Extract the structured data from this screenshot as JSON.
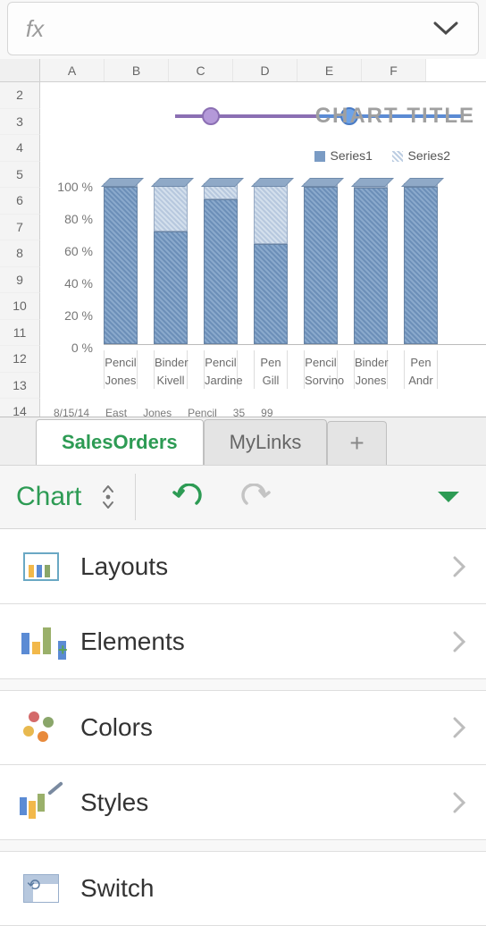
{
  "formula_bar": {
    "fx": "fx",
    "value": ""
  },
  "columns": [
    "A",
    "B",
    "C",
    "D",
    "E",
    "F"
  ],
  "rows": [
    "2",
    "3",
    "4",
    "5",
    "6",
    "7",
    "8",
    "9",
    "10",
    "11",
    "12",
    "13",
    "14"
  ],
  "chart": {
    "title": "CHART TITLE",
    "legend": {
      "s1": "Series1",
      "s2": "Series2"
    }
  },
  "chart_data": {
    "type": "bar",
    "stacked": true,
    "ylim": [
      0,
      100
    ],
    "y_ticks": [
      "100 %",
      "80 %",
      "60 %",
      "40 %",
      "20 %",
      "0 %"
    ],
    "categories": [
      {
        "item": "Pencil",
        "rep": "Jones"
      },
      {
        "item": "Binder",
        "rep": "Kivell"
      },
      {
        "item": "Pencil",
        "rep": "Jardine"
      },
      {
        "item": "Pen",
        "rep": "Gill"
      },
      {
        "item": "Pencil",
        "rep": "Sorvino"
      },
      {
        "item": "Binder",
        "rep": "Jones"
      },
      {
        "item": "Pen",
        "rep": "Andr"
      }
    ],
    "series": [
      {
        "name": "Series1",
        "values": [
          98,
          70,
          90,
          62,
          98,
          97,
          98
        ]
      },
      {
        "name": "Series2",
        "values": [
          2,
          30,
          10,
          38,
          2,
          3,
          2
        ]
      }
    ]
  },
  "peek_row": [
    "8/15/14",
    "East",
    "Jones",
    "Pencil",
    "35",
    "99"
  ],
  "tabs": {
    "active": "SalesOrders",
    "other": "MyLinks"
  },
  "toolbar": {
    "title": "Chart"
  },
  "menu": {
    "layouts": "Layouts",
    "elements": "Elements",
    "colors": "Colors",
    "styles": "Styles",
    "switch": "Switch"
  }
}
